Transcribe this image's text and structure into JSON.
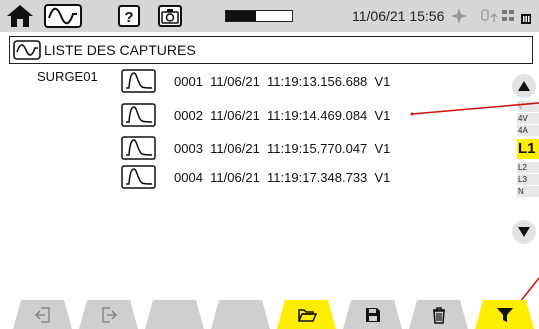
{
  "status_bar": {
    "datetime": "11/06/21 15:56",
    "battery_level": 0.45,
    "icons": [
      "home-icon",
      "waveform-mode-icon",
      "help-icon",
      "camera-icon",
      "battery-icon",
      "gps-icon",
      "network-icon",
      "memory-icon"
    ]
  },
  "title_bar": {
    "icon": "waveform-icon",
    "title": "LISTE DES CAPTURES"
  },
  "captures": {
    "file": "SURGE01",
    "items": [
      {
        "number": "0001",
        "date": "11/06/21",
        "time": "11:19:13.156.688",
        "channel": "V1"
      },
      {
        "number": "0002",
        "date": "11/06/21",
        "time": "11:19:14.469.084",
        "channel": "V1"
      },
      {
        "number": "0003",
        "date": "11/06/21",
        "time": "11:19:15.770.047",
        "channel": "V1"
      },
      {
        "number": "0004",
        "date": "11/06/21",
        "time": "11:19:17.348.733",
        "channel": "V1"
      }
    ]
  },
  "channel_rail": {
    "items": [
      "V",
      "4V",
      "4A"
    ],
    "selected": "L1",
    "below": [
      "L2",
      "L3",
      "N"
    ]
  },
  "toolbar": {
    "tabs": [
      {
        "icon": "exit-left-icon",
        "active": false
      },
      {
        "icon": "exit-right-icon",
        "active": false
      },
      {
        "icon": "",
        "active": false
      },
      {
        "icon": "",
        "active": false
      },
      {
        "icon": "folder-icon",
        "active": true
      },
      {
        "icon": "save-icon",
        "active": false
      },
      {
        "icon": "trash-icon",
        "active": false
      },
      {
        "icon": "filter-icon",
        "active": true
      }
    ]
  },
  "colors": {
    "accent": "#ffee00",
    "pointer": "#cc1010",
    "tab_inactive": "#cfcfcf",
    "status_bar": "#d6d6d6"
  }
}
